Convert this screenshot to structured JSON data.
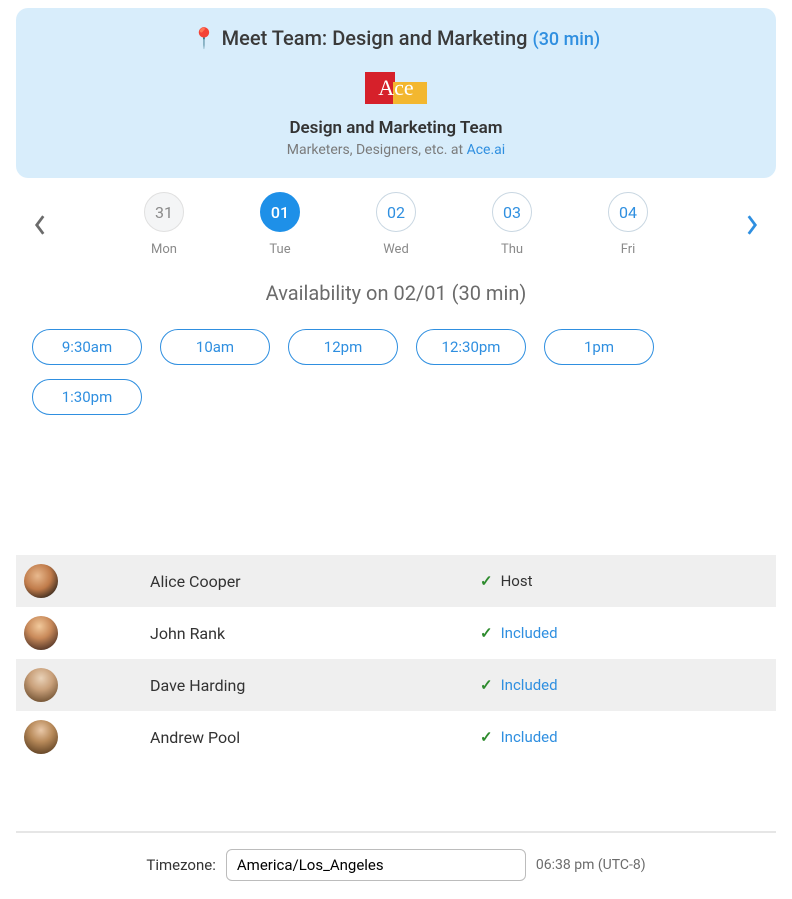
{
  "header": {
    "pin_icon": "📍",
    "title_prefix": "Meet Team: ",
    "title": "Design and Marketing",
    "duration": "30 min",
    "logo_text": "Ace",
    "team_name": "Design and Marketing Team",
    "team_sub_prefix": "Marketers, Designers, etc. at ",
    "team_link": "Ace.ai"
  },
  "dates": {
    "prev_icon": "chevron-left",
    "next_icon": "chevron-right",
    "days": [
      {
        "num": "31",
        "label": "Mon",
        "state": "dim"
      },
      {
        "num": "01",
        "label": "Tue",
        "state": "active"
      },
      {
        "num": "02",
        "label": "Wed",
        "state": ""
      },
      {
        "num": "03",
        "label": "Thu",
        "state": ""
      },
      {
        "num": "04",
        "label": "Fri",
        "state": ""
      }
    ]
  },
  "availability": {
    "heading": "Availability on 02/01 (30 min)",
    "slots": [
      "9:30am",
      "10am",
      "12pm",
      "12:30pm",
      "1pm",
      "1:30pm"
    ]
  },
  "people": [
    {
      "name": "Alice Cooper",
      "role": "Host",
      "role_type": "host"
    },
    {
      "name": "John Rank",
      "role": "Included",
      "role_type": "inc"
    },
    {
      "name": "Dave Harding",
      "role": "Included",
      "role_type": "inc"
    },
    {
      "name": "Andrew Pool",
      "role": "Included",
      "role_type": "inc"
    }
  ],
  "timezone": {
    "label": "Timezone:",
    "value": "America/Los_Angeles",
    "time": "06:38 pm (UTC-8)"
  }
}
